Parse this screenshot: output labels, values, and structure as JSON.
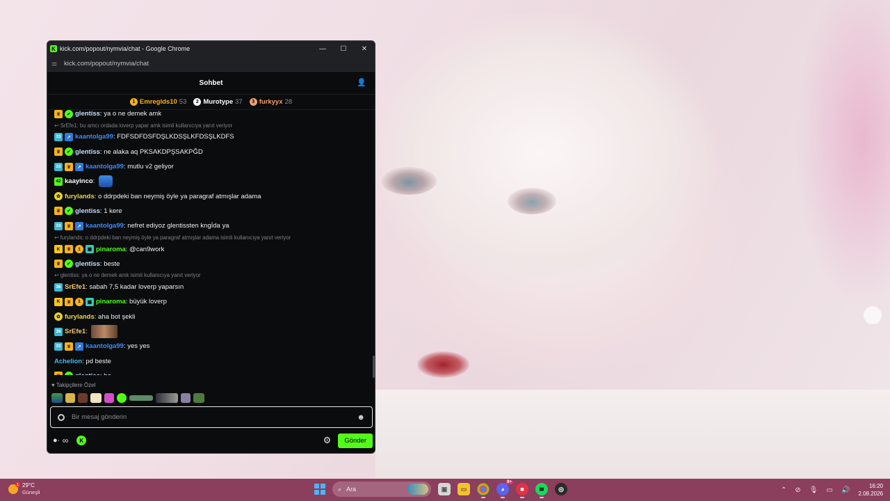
{
  "window": {
    "title": "kick.com/popout/nymvia/chat - Google Chrome",
    "url": "kick.com/popout/nymvia/chat",
    "favicon_letter": "K",
    "minimize": "—",
    "maximize": "☐",
    "close": "✕"
  },
  "chat": {
    "header_title": "Sohbet",
    "leaderboard": [
      {
        "rank": "1",
        "name": "Emreglds10",
        "count": "53",
        "color": "#f5b31d"
      },
      {
        "rank": "2",
        "name": "Murotype",
        "count": "37",
        "color": "#ffffff"
      },
      {
        "rank": "3",
        "name": "furkyyx",
        "count": "28",
        "color": "#f5a06a"
      }
    ],
    "messages": [
      {
        "kind": "msg",
        "badges": [
          "crown",
          "verified"
        ],
        "user": "glentiss",
        "user_color": "#c4dfff",
        "text": "ya o ne demek amk"
      },
      {
        "kind": "reply",
        "text": "SrEfe1: bu amcı ordada loverp yapar amk isimli kullanıcıya yanıt veriyor"
      },
      {
        "kind": "msg",
        "badges": [
          "sub",
          "x"
        ],
        "sub_num": "33",
        "user": "kaantolga99",
        "user_color": "#3b8bff",
        "text": "FDFSDFDSFDŞLKDSŞLKFDSŞLKDFS"
      },
      {
        "kind": "msg",
        "badges": [
          "crown",
          "verified"
        ],
        "user": "glentiss",
        "user_color": "#c4dfff",
        "text": "ne alaka aq PKSAKDPŞSAKPĞD"
      },
      {
        "kind": "msg",
        "badges": [
          "sub",
          "crown",
          "x"
        ],
        "sub_num": "33",
        "user": "kaantolga99",
        "user_color": "#3b8bff",
        "text": "mutlu v2 geliyor"
      },
      {
        "kind": "msg",
        "badges": [
          "green"
        ],
        "sub_num": "42",
        "user": "kaayinco",
        "user_color": "#ffffff",
        "text": "",
        "emote": "box"
      },
      {
        "kind": "msg",
        "badges": [
          "dragon"
        ],
        "user": "furylands",
        "user_color": "#e9d84c",
        "text": "o ddrpdeki ban neymiş öyle ya paragraf atmışlar adama"
      },
      {
        "kind": "msg",
        "badges": [
          "crown",
          "verified"
        ],
        "user": "glentiss",
        "user_color": "#c4dfff",
        "text": "1 kere"
      },
      {
        "kind": "msg",
        "badges": [
          "sub",
          "crown",
          "x"
        ],
        "sub_num": "33",
        "user": "kaantolga99",
        "user_color": "#3b8bff",
        "text": "nefret ediyoz glentissten kngİda ya"
      },
      {
        "kind": "reply",
        "text": "furylands: o ddrpdeki ban neymiş öyle ya paragraf atmışlar adama isimli kullanıcıya yanıt veriyor"
      },
      {
        "kind": "msg",
        "badges": [
          "kick",
          "crown",
          "one",
          "qr"
        ],
        "user": "pinaroma",
        "user_color": "#53fc18",
        "text": "@can9work"
      },
      {
        "kind": "msg",
        "badges": [
          "crown",
          "verified"
        ],
        "user": "glentiss",
        "user_color": "#c4dfff",
        "text": "beste"
      },
      {
        "kind": "reply",
        "text": "glentiss: ya o ne demek amk isimli kullanıcıya yanıt veriyor"
      },
      {
        "kind": "msg",
        "badges": [
          "sub"
        ],
        "sub_num": "36",
        "user": "SrEfe1",
        "user_color": "#f7ca6f",
        "text": "sabah 7,5 kadar loverp yaparsın"
      },
      {
        "kind": "msg",
        "badges": [
          "kick",
          "crown",
          "one",
          "qr"
        ],
        "user": "pinaroma",
        "user_color": "#53fc18",
        "text": "büyük loverp"
      },
      {
        "kind": "msg",
        "badges": [
          "dragon"
        ],
        "user": "furylands",
        "user_color": "#e9d84c",
        "text": "aha bot şekli"
      },
      {
        "kind": "msg",
        "badges": [
          "sub"
        ],
        "sub_num": "36",
        "user": "SrEfe1",
        "user_color": "#f7ca6f",
        "text": "",
        "emote": "pic"
      },
      {
        "kind": "msg",
        "badges": [
          "sub",
          "crown",
          "x"
        ],
        "sub_num": "33",
        "user": "kaantolga99",
        "user_color": "#3b8bff",
        "text": "yes yes"
      },
      {
        "kind": "msg",
        "badges": [],
        "user": "Achelion",
        "user_color": "#3fb8f0",
        "text": "pd beste"
      },
      {
        "kind": "msg",
        "badges": [
          "crown",
          "verified"
        ],
        "user": "glentiss",
        "user_color": "#c4dfff",
        "text": "he"
      }
    ],
    "followers_label": "♥ Takipçilere Özel",
    "input_placeholder": "Bir mesaj gönderin",
    "send_label": "Gönder"
  },
  "taskbar": {
    "weather_temp": "29°C",
    "weather_cond": "Güneşli",
    "weather_badge": "1",
    "search_label": "Ara",
    "discord_badge": "9+",
    "time": "16:20",
    "date": "2.08.2026"
  },
  "colors": {
    "kick_green": "#53fc18",
    "taskbar": "#8c3e5d"
  }
}
